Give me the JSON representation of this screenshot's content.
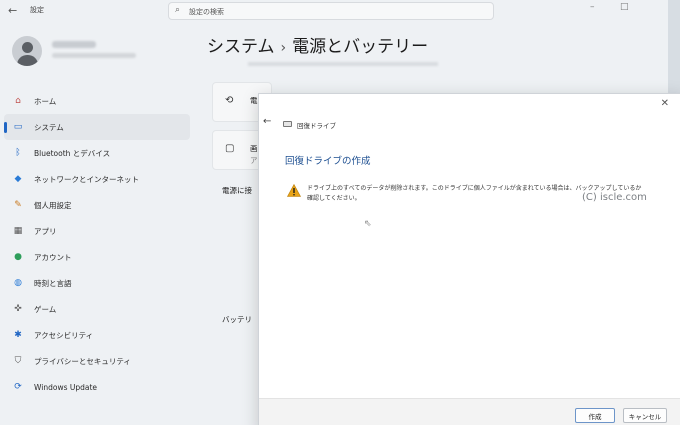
{
  "titlebar": {
    "back_glyph": "←",
    "app_title": "設定",
    "search_placeholder": "設定の検索",
    "minimize_glyph": "–",
    "maximize_glyph": "□"
  },
  "sidebar": {
    "items": [
      {
        "label": "ホーム",
        "icon": "home-icon",
        "glyph": "⌂",
        "color": "#c0504d"
      },
      {
        "label": "システム",
        "icon": "system-icon",
        "glyph": "▭",
        "color": "#2066c4"
      },
      {
        "label": "Bluetooth とデバイス",
        "icon": "bluetooth-icon",
        "glyph": "ᛒ",
        "color": "#2066c4"
      },
      {
        "label": "ネットワークとインターネット",
        "icon": "network-icon",
        "glyph": "◆",
        "color": "#2a7bd6"
      },
      {
        "label": "個人用設定",
        "icon": "brush-icon",
        "glyph": "✎",
        "color": "#c8791f"
      },
      {
        "label": "アプリ",
        "icon": "apps-icon",
        "glyph": "▦",
        "color": "#555555"
      },
      {
        "label": "アカウント",
        "icon": "account-icon",
        "glyph": "●",
        "color": "#2e9e5b"
      },
      {
        "label": "時刻と言語",
        "icon": "globe-icon",
        "glyph": "◍",
        "color": "#2a7bd6"
      },
      {
        "label": "ゲーム",
        "icon": "gamepad-icon",
        "glyph": "✜",
        "color": "#666666"
      },
      {
        "label": "アクセシビリティ",
        "icon": "accessibility-icon",
        "glyph": "✱",
        "color": "#2066c4"
      },
      {
        "label": "プライバシーとセキュリティ",
        "icon": "shield-icon",
        "glyph": "⛉",
        "color": "#555555"
      },
      {
        "label": "Windows Update",
        "icon": "update-icon",
        "glyph": "⟳",
        "color": "#2066c4"
      }
    ],
    "active_index": 1
  },
  "main": {
    "breadcrumb_parent": "システム",
    "breadcrumb_sep": "›",
    "breadcrumb_current": "電源とバッテリー",
    "card1_title": "電",
    "card2_title": "画",
    "card2_sub": "ア",
    "section_power": "電源に接",
    "section_battery": "バッテリ"
  },
  "dialog": {
    "close_glyph": "✕",
    "back_glyph": "←",
    "title": "回復ドライブ",
    "heading": "回復ドライブの作成",
    "warning": "ドライブ上のすべてのデータが削除されます。このドライブに個人ファイルが含まれている場合は、バックアップしているか確認してください。",
    "create_label": "作成",
    "cancel_label": "キャンセル"
  },
  "watermark": "(C) iscle.com"
}
